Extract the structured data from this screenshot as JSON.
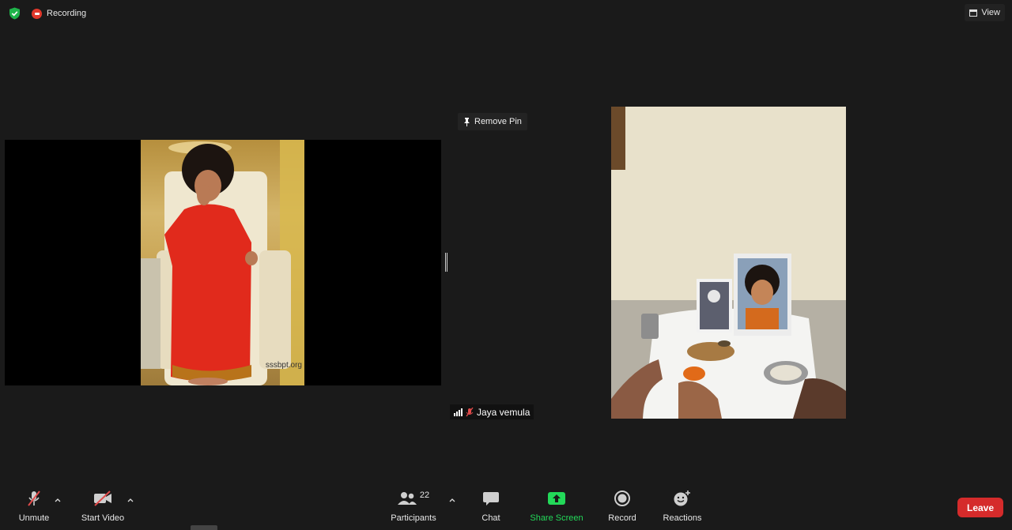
{
  "topbar": {
    "recording_label": "Recording",
    "view_label": "View"
  },
  "stage": {
    "remove_pin_label": "Remove Pin",
    "left_watermark": "sssbpt.org",
    "participant_name": "Jaya vemula"
  },
  "toolbar": {
    "unmute_label": "Unmute",
    "start_video_label": "Start Video",
    "participants_label": "Participants",
    "participants_count": "22",
    "chat_label": "Chat",
    "share_screen_label": "Share Screen",
    "record_label": "Record",
    "reactions_label": "Reactions",
    "leave_label": "Leave"
  },
  "colors": {
    "background": "#1a1a1a",
    "share_green": "#23d959",
    "leave_red": "#d52b2b",
    "recording_red": "#e2382b",
    "shield_green": "#1fb34a"
  }
}
